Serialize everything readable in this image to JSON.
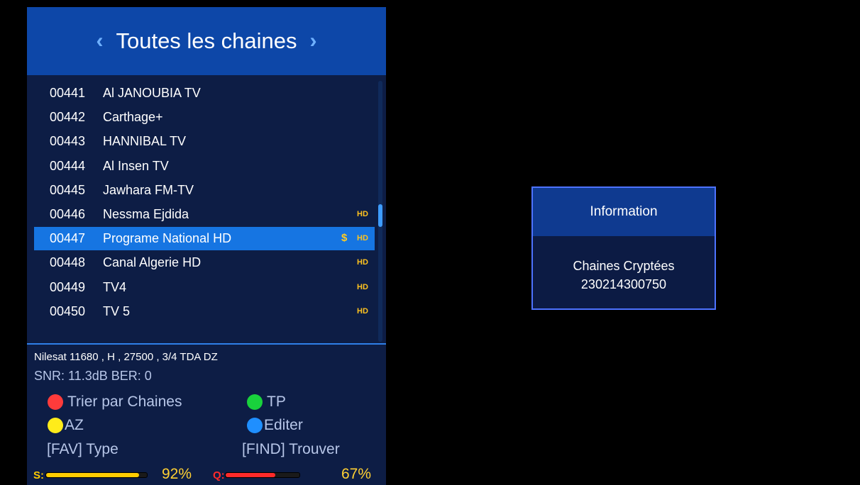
{
  "header": {
    "title": "Toutes les chaines",
    "prev_icon": "chevron-left-icon",
    "next_icon": "chevron-right-icon"
  },
  "channels": [
    {
      "num": "00441",
      "name": "Al JANOUBIA TV",
      "scrambled": "",
      "hd": ""
    },
    {
      "num": "00442",
      "name": "Carthage+",
      "scrambled": "",
      "hd": ""
    },
    {
      "num": "00443",
      "name": "HANNIBAL TV",
      "scrambled": "",
      "hd": ""
    },
    {
      "num": "00444",
      "name": "Al Insen TV",
      "scrambled": "",
      "hd": ""
    },
    {
      "num": "00445",
      "name": "Jawhara FM-TV",
      "scrambled": "",
      "hd": ""
    },
    {
      "num": "00446",
      "name": "Nessma Ejdida",
      "scrambled": "",
      "hd": "HD"
    },
    {
      "num": "00447",
      "name": "Programe National HD",
      "scrambled": "$",
      "hd": "HD"
    },
    {
      "num": "00448",
      "name": "Canal Algerie HD",
      "scrambled": "",
      "hd": "HD"
    },
    {
      "num": "00449",
      "name": "TV4",
      "scrambled": "",
      "hd": "HD"
    },
    {
      "num": "00450",
      "name": "TV 5",
      "scrambled": "",
      "hd": "HD"
    }
  ],
  "selected_index": 6,
  "transponder": "Nilesat  11680 , H , 27500 , 3/4  TDA DZ",
  "signal_info": "SNR: 11.3dB  BER: 0",
  "keys": {
    "red": "Trier par Chaines",
    "green": "TP",
    "yellow": "AZ",
    "blue": "Editer",
    "fav": "[FAV] Type",
    "find": "[FIND] Trouver"
  },
  "strength": {
    "label": "S:",
    "value": 92,
    "text": "92%"
  },
  "quality": {
    "label": "Q:",
    "value": 67,
    "text": "67%"
  },
  "info": {
    "title": "Information",
    "line1": "Chaines Cryptées",
    "line2": "230214300750"
  },
  "colors": {
    "header_bg": "#0d47a8",
    "panel_bg": "#0d1d45",
    "selected_row": "#1675e2",
    "hd_badge": "#ffc21f",
    "key_red": "#ff3b3b",
    "key_green": "#19d23c",
    "key_yellow": "#ffec1a",
    "key_blue": "#1f8fff",
    "strength_bar": "#ffcc00",
    "quality_bar": "#ff2a2a"
  }
}
